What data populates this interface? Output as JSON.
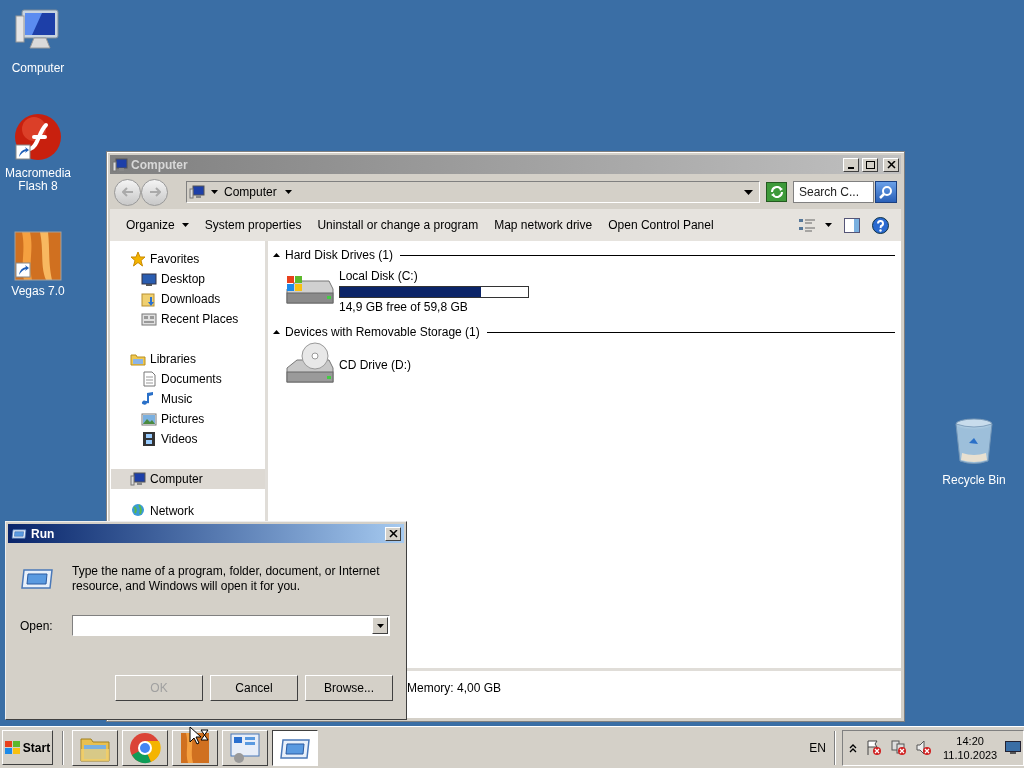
{
  "desktop_icons": [
    {
      "label": "Computer",
      "kind": "computer",
      "shortcut": false
    },
    {
      "label": "Macromedia Flash 8",
      "kind": "flash",
      "shortcut": true
    },
    {
      "label": "Vegas 7.0",
      "kind": "vegas",
      "shortcut": true
    }
  ],
  "recycle_bin": {
    "label": "Recycle Bin"
  },
  "explorer": {
    "title": "Computer",
    "address": "Computer",
    "search": {
      "placeholder": "Search C..."
    },
    "commands": [
      {
        "label": "Organize",
        "dropdown": true
      },
      {
        "label": "System properties",
        "dropdown": false
      },
      {
        "label": "Uninstall or change a program",
        "dropdown": false
      },
      {
        "label": "Map network drive",
        "dropdown": false
      },
      {
        "label": "Open Control Panel",
        "dropdown": false
      }
    ],
    "nav": [
      {
        "label": "Favorites",
        "kind": "favorites",
        "selected": false,
        "children": [
          {
            "label": "Desktop",
            "kind": "desktop",
            "selected": false
          },
          {
            "label": "Downloads",
            "kind": "downloads",
            "selected": false
          },
          {
            "label": "Recent Places",
            "kind": "recent",
            "selected": false
          }
        ]
      },
      {
        "label": "Libraries",
        "kind": "libraries",
        "selected": false,
        "children": [
          {
            "label": "Documents",
            "kind": "documents",
            "selected": false
          },
          {
            "label": "Music",
            "kind": "music",
            "selected": false
          },
          {
            "label": "Pictures",
            "kind": "pictures",
            "selected": false
          },
          {
            "label": "Videos",
            "kind": "videos",
            "selected": false
          }
        ]
      },
      {
        "label": "Computer",
        "kind": "computer",
        "selected": true
      },
      {
        "label": "Network",
        "kind": "network",
        "selected": false
      }
    ],
    "groups": [
      {
        "title": "Hard Disk Drives (1)",
        "items": [
          {
            "kind": "disk",
            "name": "Local Disk (C:)",
            "level": 0.75,
            "reading": "14,9 GB free of 59,8 GB"
          }
        ]
      },
      {
        "title": "Devices with Removable Storage (1)",
        "items": [
          {
            "kind": "cd",
            "name": "CD Drive (D:)"
          }
        ]
      }
    ],
    "details": "Memory: 4,00 GB"
  },
  "run_dialog": {
    "title": "Run",
    "message": "Type the name of a program, folder, document, or Internet resource, and Windows will open it for you.",
    "open_label": "Open:",
    "buttons": [
      {
        "label": "OK",
        "disabled": true
      },
      {
        "label": "Cancel",
        "disabled": false
      },
      {
        "label": "Browse...",
        "disabled": false
      }
    ]
  },
  "taskbar": {
    "start": "Start",
    "tasks": [
      {
        "kind": "folder",
        "selected": false
      },
      {
        "kind": "chrome",
        "selected": false
      },
      {
        "kind": "vegas",
        "selected": false
      },
      {
        "kind": "control",
        "selected": false
      },
      {
        "kind": "run",
        "selected": true
      }
    ],
    "language": "EN",
    "time": "14:20",
    "date": "11.10.2023"
  }
}
